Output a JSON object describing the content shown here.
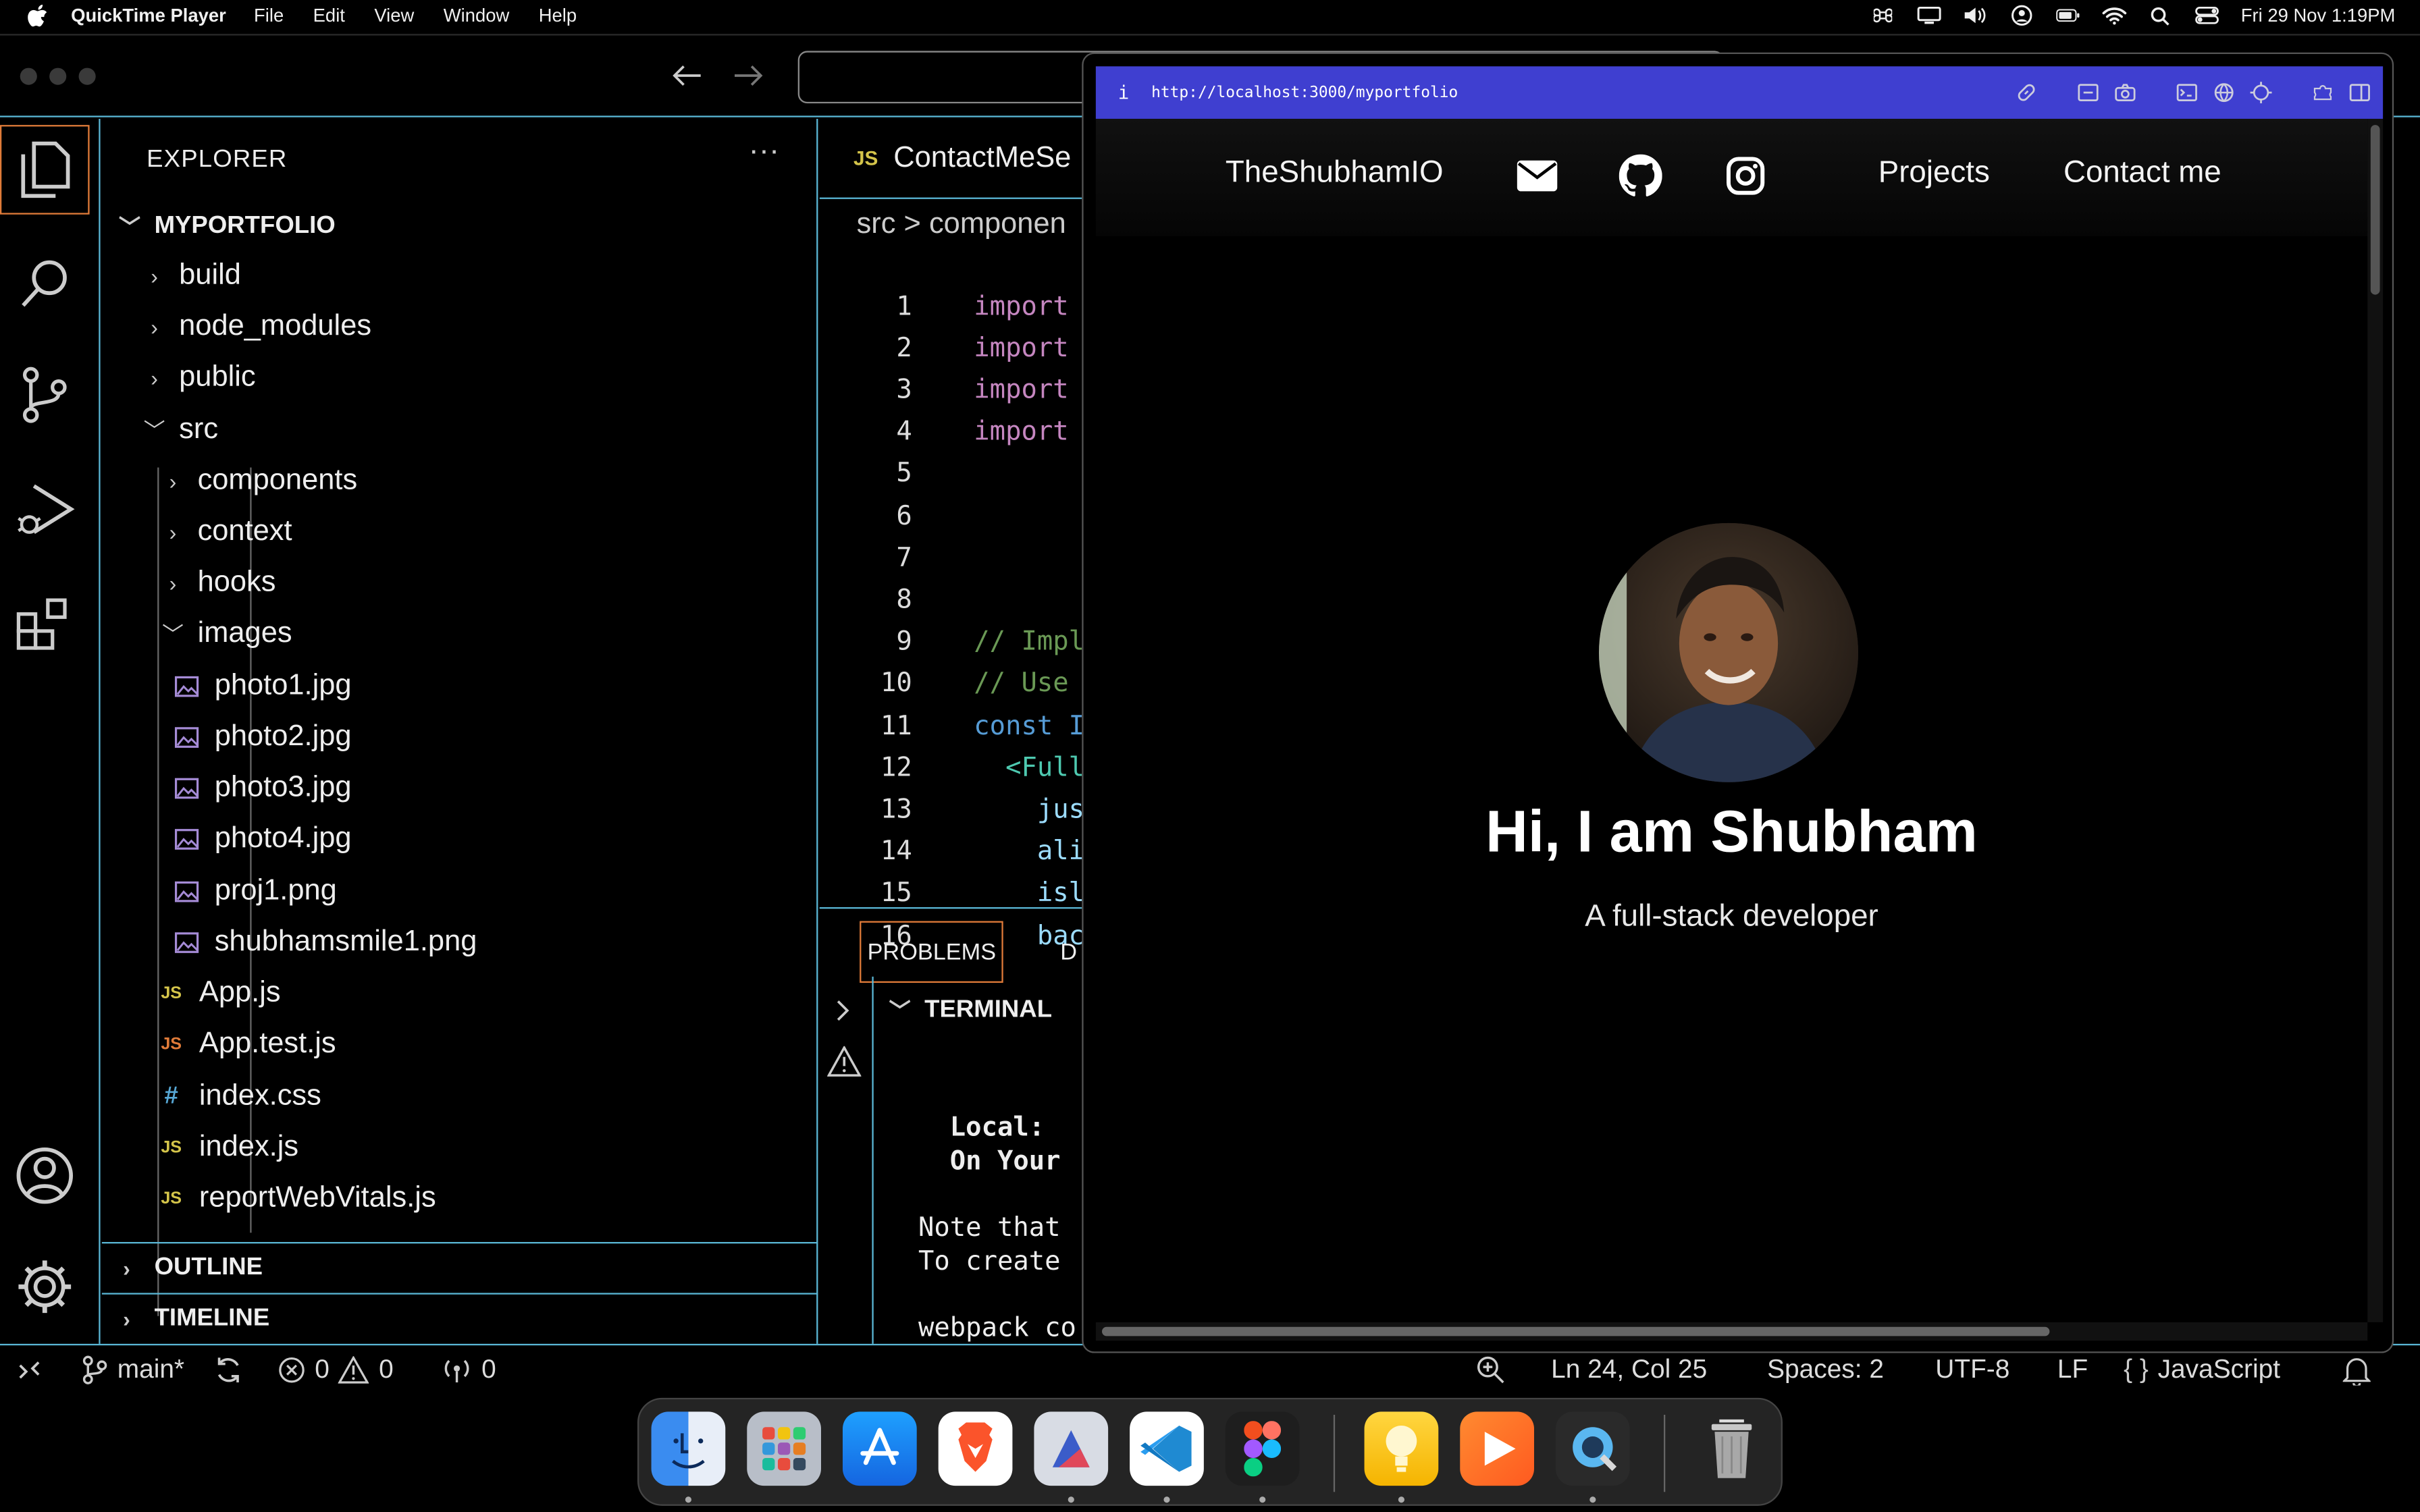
{
  "menubar": {
    "app_name": "QuickTime Player",
    "menus": [
      "File",
      "Edit",
      "View",
      "Window",
      "Help"
    ],
    "datetime": "Fri 29 Nov  1:19PM"
  },
  "vscode": {
    "explorer_title": "EXPLORER",
    "project_name": "MYPORTFOLIO",
    "tree": [
      {
        "label": "build",
        "kind": "folder"
      },
      {
        "label": "node_modules",
        "kind": "folder"
      },
      {
        "label": "public",
        "kind": "folder"
      },
      {
        "label": "src",
        "kind": "folder-open"
      },
      {
        "label": "components",
        "kind": "folder"
      },
      {
        "label": "context",
        "kind": "folder"
      },
      {
        "label": "hooks",
        "kind": "folder"
      },
      {
        "label": "images",
        "kind": "folder-open"
      },
      {
        "label": "photo1.jpg",
        "kind": "image"
      },
      {
        "label": "photo2.jpg",
        "kind": "image"
      },
      {
        "label": "photo3.jpg",
        "kind": "image"
      },
      {
        "label": "photo4.jpg",
        "kind": "image"
      },
      {
        "label": "proj1.png",
        "kind": "image"
      },
      {
        "label": "shubhamsmile1.png",
        "kind": "image"
      },
      {
        "label": "App.js",
        "kind": "js"
      },
      {
        "label": "App.test.js",
        "kind": "js"
      },
      {
        "label": "index.css",
        "kind": "css"
      },
      {
        "label": "index.js",
        "kind": "js"
      },
      {
        "label": "reportWebVitals.js",
        "kind": "js"
      }
    ],
    "outline_label": "OUTLINE",
    "timeline_label": "TIMELINE",
    "tab_name": "ContactMeSe",
    "breadcrumb": "src  >  componen",
    "code_lines": [
      {
        "n": "1",
        "text": "import",
        "cls": "kw"
      },
      {
        "n": "2",
        "text": "import",
        "cls": "kw"
      },
      {
        "n": "3",
        "text": "import",
        "cls": "kw"
      },
      {
        "n": "4",
        "text": "import",
        "cls": "kw"
      },
      {
        "n": "5",
        "text": "",
        "cls": ""
      },
      {
        "n": "6",
        "text": "",
        "cls": ""
      },
      {
        "n": "7",
        "text": "",
        "cls": ""
      },
      {
        "n": "8",
        "text": "",
        "cls": ""
      },
      {
        "n": "9",
        "text": "// Impl",
        "cls": "cm"
      },
      {
        "n": "10",
        "text": "// Use",
        "cls": "cm"
      },
      {
        "n": "11",
        "text": "const I",
        "cls": "bl"
      },
      {
        "n": "12",
        "text": "  <Full",
        "cls": "tag"
      },
      {
        "n": "13",
        "text": "    jus",
        "cls": "attr"
      },
      {
        "n": "14",
        "text": "    ali",
        "cls": "attr"
      },
      {
        "n": "15",
        "text": "    isl",
        "cls": "attr"
      },
      {
        "n": "16",
        "text": "    bac",
        "cls": "attr"
      }
    ],
    "panel_tab_problems": "PROBLEMS",
    "panel_tab_next": "D",
    "terminal_label": "TERMINAL",
    "terminal_lines": [
      "  Local:",
      "  On Your",
      "Note that",
      "To create",
      "webpack co"
    ],
    "status": {
      "branch": "main*",
      "errors": "0",
      "warnings": "0",
      "ports": "0",
      "position": "Ln 24, Col 25",
      "spaces": "Spaces: 2",
      "encoding": "UTF-8",
      "eol": "LF",
      "language": "JavaScript"
    }
  },
  "browser": {
    "info": "i",
    "url": "http://localhost:3000/myportfolio",
    "brand": "TheShubhamIO",
    "nav_links": [
      "Projects",
      "Contact me"
    ],
    "hero_title": "Hi, I am Shubham",
    "hero_subtitle": "A full-stack developer",
    "accent": "#3f3fd0"
  },
  "dock": {
    "apps": [
      "finder-icon",
      "launchpad-icon",
      "app-store-icon",
      "brave-icon",
      "affinity-icon",
      "vscode-icon",
      "figma-icon",
      "tips-icon",
      "infuse-icon",
      "quicktime-icon",
      "trash-icon"
    ]
  },
  "colors": {
    "border_accent": "#5ab7d6",
    "focus_orange": "#e07b39"
  }
}
